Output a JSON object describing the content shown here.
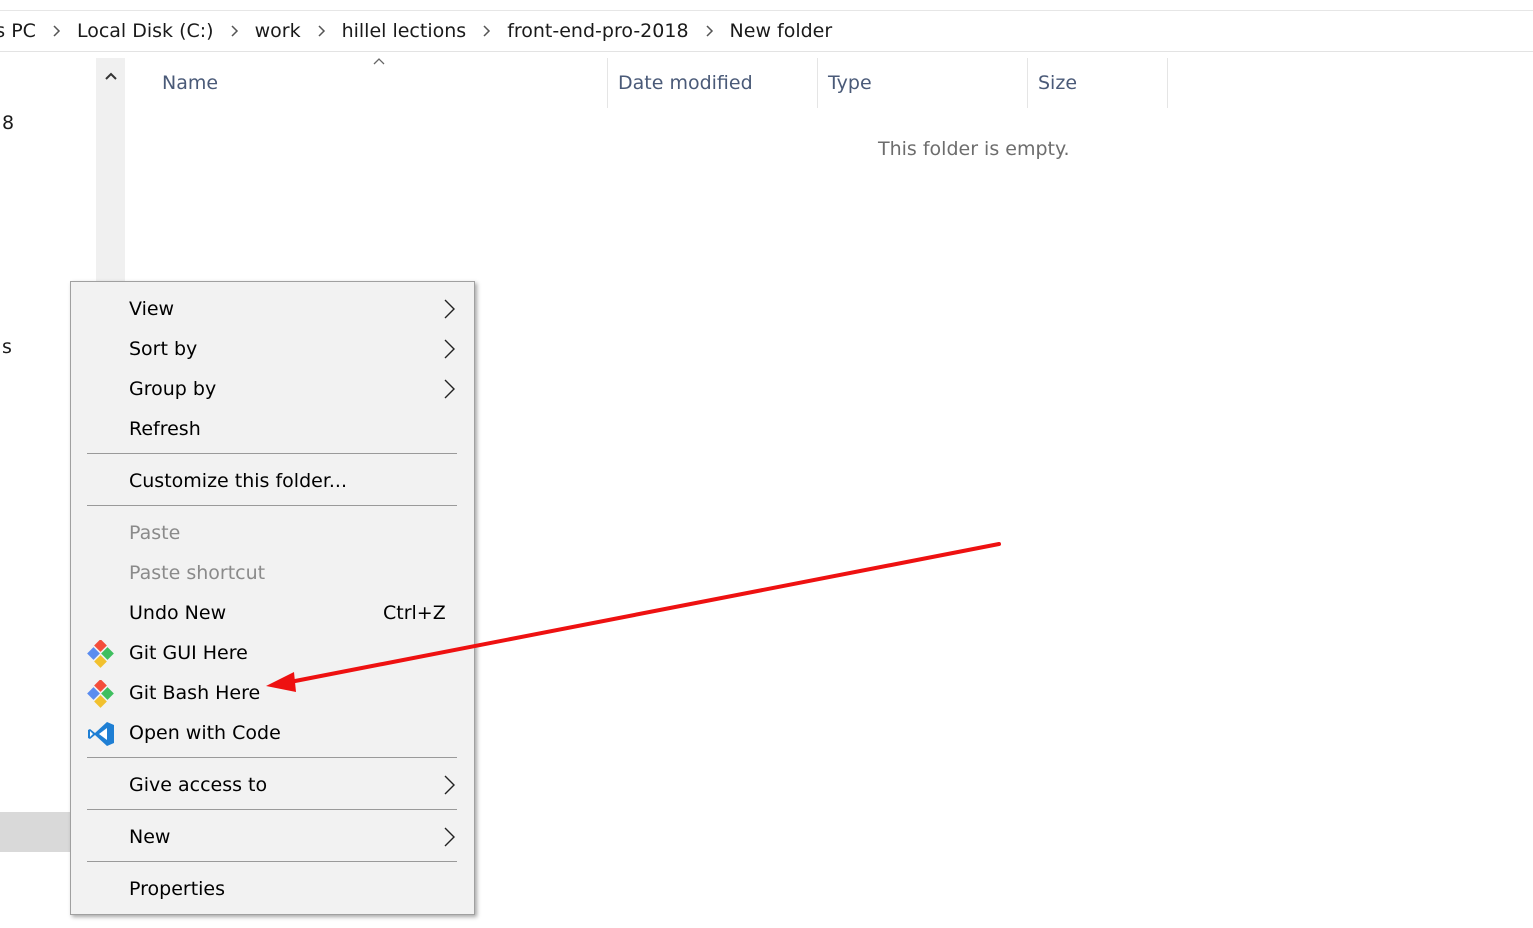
{
  "address_bar": {
    "crumbs": [
      "is PC",
      "Local Disk (C:)",
      "work",
      "hillel lections",
      "front-end-pro-2018",
      "New folder"
    ]
  },
  "nav_pane": {
    "items": [
      "8",
      "s"
    ]
  },
  "columns": {
    "name": "Name",
    "date_modified": "Date modified",
    "type": "Type",
    "size": "Size"
  },
  "empty_message": "This folder is empty.",
  "context_menu": {
    "items": [
      {
        "label": "View",
        "submenu": true
      },
      {
        "label": "Sort by",
        "submenu": true
      },
      {
        "label": "Group by",
        "submenu": true
      },
      {
        "label": "Refresh"
      },
      {
        "label": "Customize this folder..."
      },
      {
        "label": "Paste",
        "disabled": true
      },
      {
        "label": "Paste shortcut",
        "disabled": true
      },
      {
        "label": "Undo New",
        "shortcut": "Ctrl+Z"
      },
      {
        "label": "Git GUI Here",
        "icon": "git-icon"
      },
      {
        "label": "Git Bash Here",
        "icon": "git-icon"
      },
      {
        "label": "Open with Code",
        "icon": "vscode-icon"
      },
      {
        "label": "Give access to",
        "submenu": true
      },
      {
        "label": "New",
        "submenu": true
      },
      {
        "label": "Properties"
      }
    ]
  },
  "annotation": {
    "arrow_color": "#ee1111"
  },
  "colors": {
    "menu_bg": "#f2f2f2",
    "header_text": "#4a5a78",
    "selection": "#d9d9d9"
  }
}
